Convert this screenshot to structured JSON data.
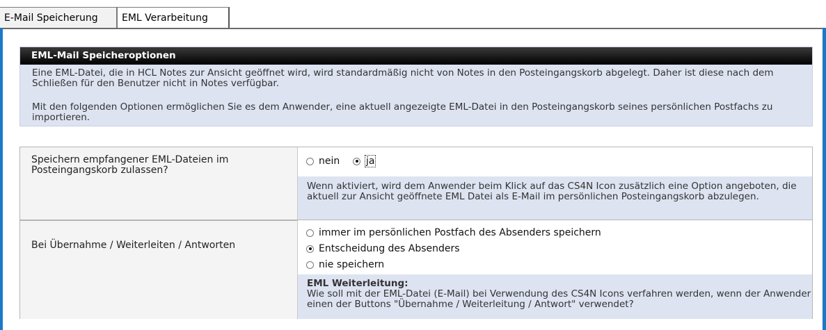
{
  "tabs": [
    {
      "label": "E-Mail Speicherung",
      "active": false
    },
    {
      "label": "EML Verarbeitung",
      "active": true
    }
  ],
  "info": {
    "title": "EML-Mail Speicheroptionen",
    "para1": "Eine EML-Datei, die in HCL Notes zur Ansicht geöffnet wird, wird standardmäßig nicht von Notes in den Posteingangskorb abgelegt. Daher ist diese nach dem Schließen für den Benutzer nicht in Notes verfügbar.",
    "para2": "Mit den folgenden Optionen ermöglichen Sie es dem Anwender, eine aktuell angezeigte EML-Datei in den Posteingangskorb seines persönlichen Postfachs zu importieren."
  },
  "setting1": {
    "label": "Speichern empfangener EML-Dateien im Posteingangskorb zulassen?",
    "options": [
      "nein",
      "ja"
    ],
    "selected": "ja",
    "hint": "Wenn aktiviert, wird dem Anwender beim Klick auf das CS4N Icon zusätzlich eine Option angeboten, die aktuell zur Ansicht geöffnete EML Datei als E-Mail im persönlichen Posteingangskorb abzulegen."
  },
  "setting2": {
    "label": "Bei Übernahme / Weiterleiten / Antworten",
    "options": [
      "immer im persönlichen Postfach des Absenders speichern",
      "Entscheidung des Absenders",
      "nie speichern"
    ],
    "selected": "Entscheidung des Absenders",
    "hint_title": "EML Weiterleitung:",
    "hint": "Wie soll mit der EML-Datei (E-Mail) bei Verwendung des CS4N Icons verfahren werden, wenn der Anwender einen der Buttons \"Übernahme / Weiterleitung / Antwort\" verwendet?"
  },
  "colors": {
    "accent": "#1c78c8",
    "header_bg": "#000000",
    "info_bg": "#dde3f1"
  }
}
